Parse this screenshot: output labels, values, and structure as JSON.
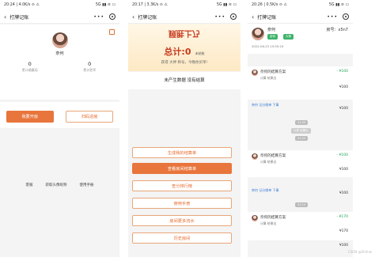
{
  "frame1": {
    "status_time": "20:24 | 4.0K/s ⊙ ⚠",
    "status_right": "5G ▮▮ ≋ ▭",
    "nav_title": "打牌记账",
    "username": "奈何",
    "stats": [
      {
        "value": "0",
        "label": "累计输赢局"
      },
      {
        "value": "0",
        "label": "累计胜率"
      }
    ],
    "record": {
      "wins": "胜1天",
      "losses": "输1天",
      "rate_prefix": "胜率",
      "rate": "50%",
      "suffix": "总结 ›"
    },
    "create_room": "我要开房",
    "scan_room": "扫码进房",
    "links": [
      "客服",
      "获取头像昵称",
      "使用手册"
    ]
  },
  "frame2": {
    "status_time": "20:17 | 3.3K/s ⊙ ⚠",
    "status_right": "5G ▮▮ ≋ ▭",
    "nav_title": "打牌记账",
    "banner_title": "顾胜上乃",
    "total_label": "总计:0",
    "total_suffix": "未结账",
    "hint": "获得 大神 称号，今晚你买单!",
    "section_title": "未产生数据 没有结算",
    "menu": [
      "生成我的结算单",
      "查看房间结算单",
      "查分排行榜",
      "使用手册",
      "房间更多流水",
      "历史房间"
    ]
  },
  "frame3": {
    "status_time": "20:26 | 0.5K/s ⊙ ⚠",
    "status_right": "5G ▮▮ ≋ ▭",
    "nav_title": "打牌记账",
    "name": "奈何",
    "room_label": "房号：x5n7",
    "tag1": "奈何",
    "tag2": "大神",
    "time1": "2022-06-23 15:55:24",
    "settle_title": "奈何的结算方案",
    "settle_sub": "计算 结果出",
    "amount_a": "- ¥100",
    "amount_b": "¥100",
    "amount_c": "- ¥170",
    "amount_d": "¥170",
    "system_label": "奈何 记分储单 下事",
    "times": [
      "21:55",
      "22:25",
      "22:15"
    ],
    "watermark": "CSDN @Shhhw"
  }
}
